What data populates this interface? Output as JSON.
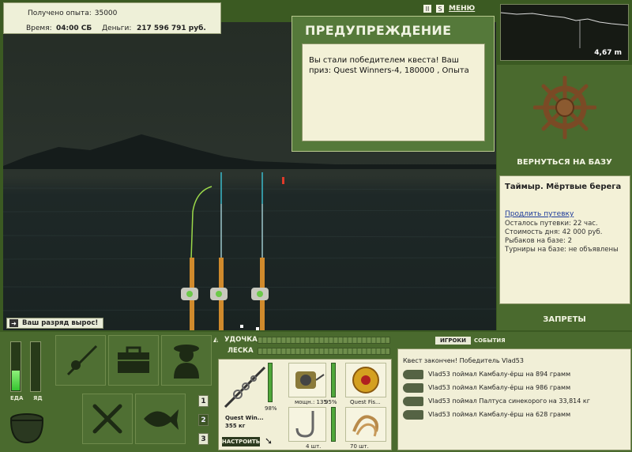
{
  "info": {
    "exp_label": "Получено опыта:",
    "exp_value": "35000",
    "time_label": "Время:",
    "time_value": "04:00 СБ",
    "money_label": "Деньги:",
    "money_value": "217 596 791 руб."
  },
  "promo": {
    "text": "Ваш разряд вырос!"
  },
  "top_icons": {
    "menu_label": "МЕНЮ",
    "pause_symbol": "II",
    "sound_symbol": "S"
  },
  "warning": {
    "title": "ПРЕДУПРЕЖДЕНИЕ",
    "message": "Вы стали победителем квеста! Ваш приз: Quest Winners-4, 180000 , Опыта"
  },
  "depth": {
    "value": "4,67 m"
  },
  "base": {
    "return_label": "ВЕРНУТЬСЯ НА БАЗУ",
    "name": "Таймыр. Мёртвые берега",
    "extend_link": "Продлить путевку",
    "lines": [
      "Осталось путевки: 22 час.",
      "Стоимость дня: 42 000 руб.",
      "Рыбаков на базе: 2",
      "Турниры на базе: не объявлены"
    ],
    "bans_label": "ЗАПРЕТЫ"
  },
  "meters": {
    "food_label": "ЕДА",
    "poison_label": "ЯД",
    "food_level": 0.4,
    "poison_level": 0
  },
  "slots": {
    "numbers": [
      "1",
      "2",
      "3"
    ],
    "active": "2"
  },
  "tackle": {
    "rod_label": "УДОЧКА",
    "line_label": "ЛЕСКА",
    "rod_name": "Quest Win...",
    "rod_weight": "355 кг",
    "rod_percent": "98%",
    "reel_stat": "мощн.: 135",
    "reel_percent": "95%",
    "line_name": "Quest Fis...",
    "hook_count": "4 шт.",
    "bait_count": "70 шт.",
    "tune_label": "НАСТРОИТЬ"
  },
  "events": {
    "tab_players": "ИГРОКИ",
    "tab_events": "СОБЫТИЯ",
    "header": "Квест закончен! Победитель Vlad53",
    "items": [
      "Vlad53 поймал Камбалу-ёрш на 894 грамм",
      "Vlad53 поймал Камбалу-ёрш на 986 грамм",
      "Vlad53 поймал Палтуса синекорого на 33,814 кг",
      "Vlad53 поймал Камбалу-ёрш на 628 грамм"
    ]
  }
}
